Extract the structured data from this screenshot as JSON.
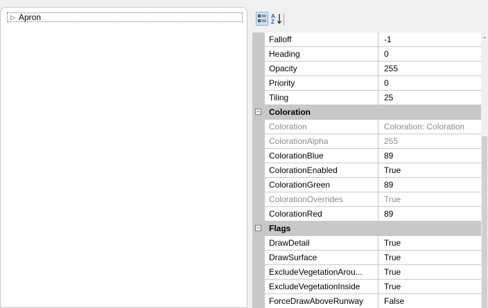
{
  "tree": {
    "items": [
      {
        "label": "Apron"
      }
    ]
  },
  "toolbar": {
    "categorized_tooltip": "Categorized",
    "alphabetical_tooltip": "Alphabetical",
    "alpha_glyph_top": "A",
    "alpha_glyph_bottom": "Z"
  },
  "grid": {
    "rows": [
      {
        "type": "prop",
        "name": "Falloff",
        "value": "-1",
        "readonly": false
      },
      {
        "type": "prop",
        "name": "Heading",
        "value": "0",
        "readonly": false
      },
      {
        "type": "prop",
        "name": "Opacity",
        "value": "255",
        "readonly": false
      },
      {
        "type": "prop",
        "name": "Priority",
        "value": "0",
        "readonly": false
      },
      {
        "type": "prop",
        "name": "Tiling",
        "value": "25",
        "readonly": false
      },
      {
        "type": "category",
        "name": "Coloration"
      },
      {
        "type": "prop",
        "name": "Coloration",
        "value": "Coloration: Coloration",
        "readonly": true
      },
      {
        "type": "prop",
        "name": "ColorationAlpha",
        "value": "255",
        "readonly": true
      },
      {
        "type": "prop",
        "name": "ColorationBlue",
        "value": "89",
        "readonly": false
      },
      {
        "type": "prop",
        "name": "ColorationEnabled",
        "value": "True",
        "readonly": false
      },
      {
        "type": "prop",
        "name": "ColorationGreen",
        "value": "89",
        "readonly": false
      },
      {
        "type": "prop",
        "name": "ColorationOverrides",
        "value": "True",
        "readonly": true
      },
      {
        "type": "prop",
        "name": "ColorationRed",
        "value": "89",
        "readonly": false
      },
      {
        "type": "category",
        "name": "Flags"
      },
      {
        "type": "prop",
        "name": "DrawDetail",
        "value": "True",
        "readonly": false
      },
      {
        "type": "prop",
        "name": "DrawSurface",
        "value": "True",
        "readonly": false
      },
      {
        "type": "prop",
        "name": "ExcludeVegetationArou...",
        "value": "True",
        "readonly": false
      },
      {
        "type": "prop",
        "name": "ExcludeVegetationInside",
        "value": "True",
        "readonly": false
      },
      {
        "type": "prop",
        "name": "ForceDrawAboveRunway",
        "value": "False",
        "readonly": false
      }
    ]
  },
  "colors": {
    "category_bg": "#c8c8c8",
    "readonly_text": "#8c8c8c",
    "selected_button": "#cce4f7"
  }
}
